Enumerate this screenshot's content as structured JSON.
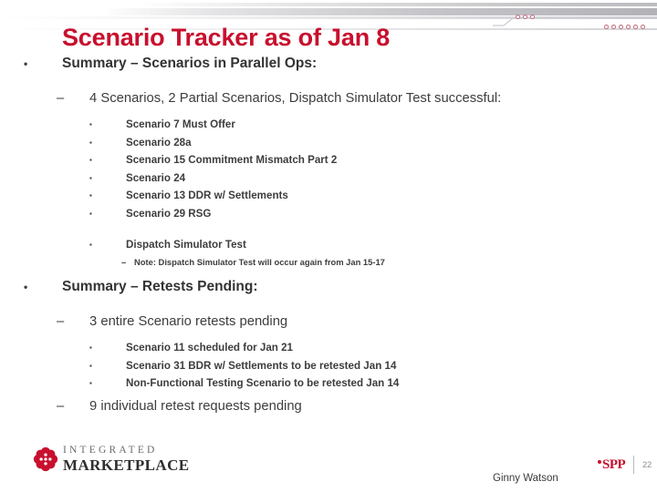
{
  "slide": {
    "title": "Scenario Tracker as of Jan 8",
    "title_color": "#c8102e",
    "page_number": "22",
    "presenter": "Ginny Watson"
  },
  "decor": {
    "dots_left_count": 3,
    "dots_right_count": 6,
    "dot_color": "#c0697a"
  },
  "markers": {
    "bullet_round": "•",
    "bullet_dash": "–",
    "bullet_square": "▪"
  },
  "body": {
    "sections": [
      {
        "heading": "Summary – Scenarios in Parallel Ops:",
        "sub": {
          "label": "4 Scenarios, 2 Partial Scenarios, Dispatch Simulator Test successful:",
          "items": [
            "Scenario 7 Must Offer",
            "Scenario 28a",
            "Scenario 15 Commitment Mismatch Part 2",
            "Scenario 24",
            "Scenario 13 DDR w/ Settlements",
            "Scenario 29 RSG"
          ],
          "extra_item": "Dispatch Simulator Test",
          "extra_note": "Note: Dispatch Simulator Test will occur again from Jan 15-17"
        }
      },
      {
        "heading": "Summary – Retests Pending:",
        "sub1": {
          "label": "3 entire Scenario retests pending",
          "items": [
            "Scenario 11 scheduled for Jan 21",
            "Scenario 31 BDR w/ Settlements to be retested Jan 14",
            "Non-Functional Testing Scenario to be retested Jan 14"
          ]
        },
        "sub2": {
          "label": "9 individual retest requests pending"
        }
      }
    ]
  },
  "footer": {
    "logo_line1": "INTEGRATED",
    "logo_line2": "MARKETPLACE",
    "spp_text": "SPP"
  }
}
